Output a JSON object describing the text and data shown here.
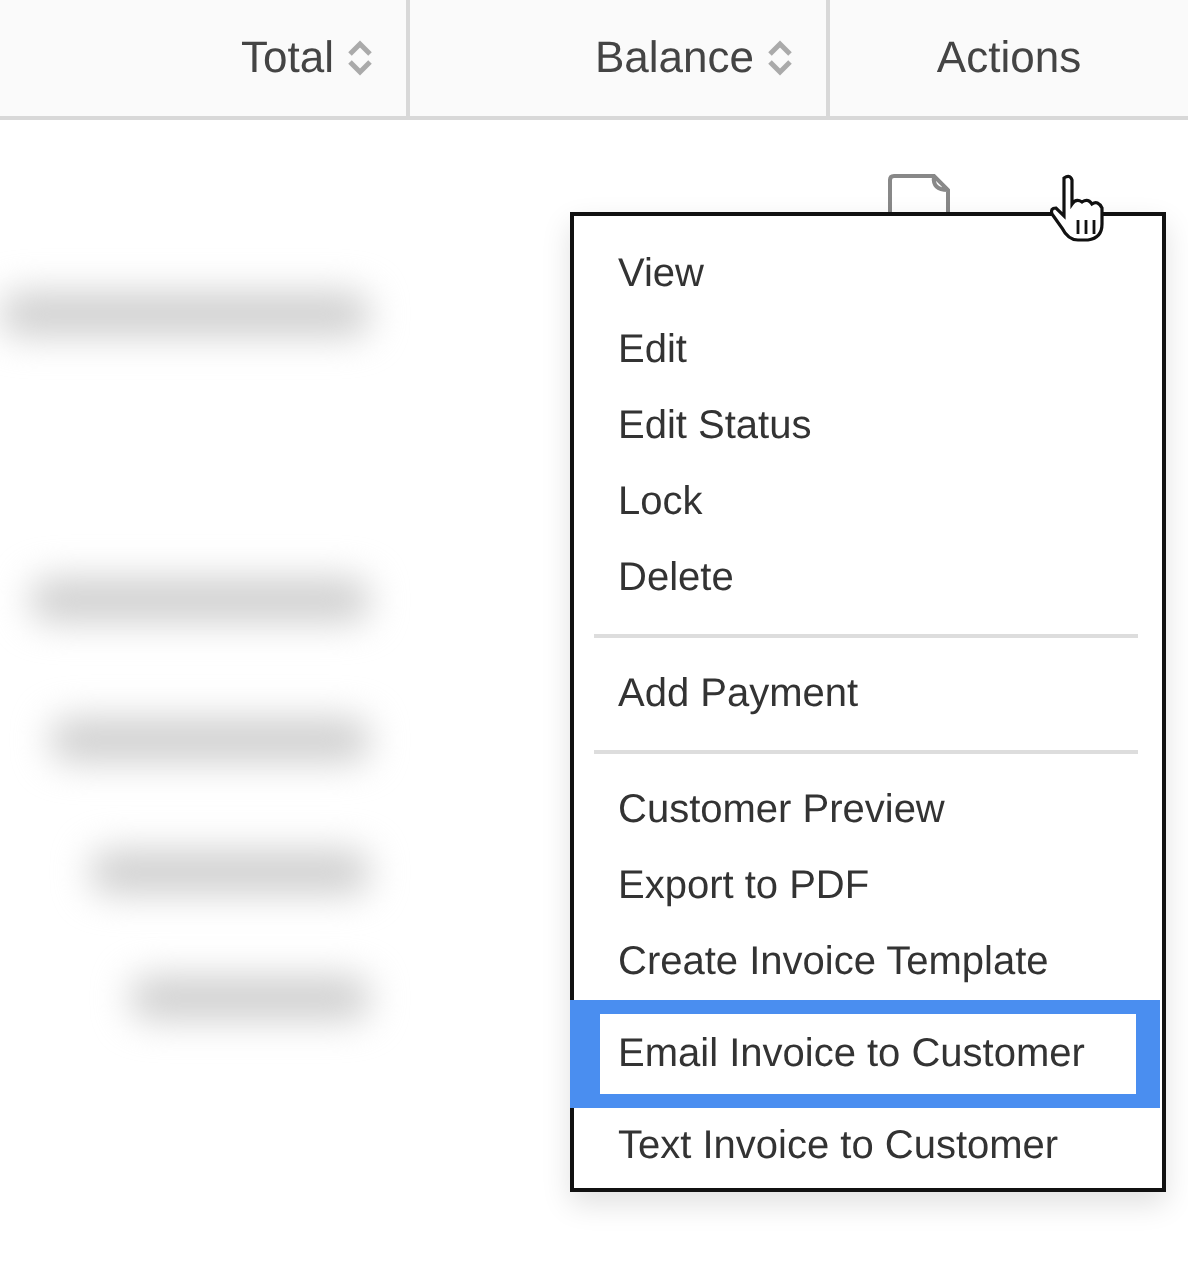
{
  "table": {
    "columns": [
      {
        "label": "Total",
        "sortable": true
      },
      {
        "label": "Balance",
        "sortable": true
      },
      {
        "label": "Actions",
        "sortable": false
      }
    ]
  },
  "menu": {
    "groups": [
      {
        "items": [
          {
            "label": "View",
            "highlighted": false
          },
          {
            "label": "Edit",
            "highlighted": false
          },
          {
            "label": "Edit Status",
            "highlighted": false
          },
          {
            "label": "Lock",
            "highlighted": false
          },
          {
            "label": "Delete",
            "highlighted": false
          }
        ]
      },
      {
        "items": [
          {
            "label": "Add Payment",
            "highlighted": false
          }
        ]
      },
      {
        "items": [
          {
            "label": "Customer Preview",
            "highlighted": false
          },
          {
            "label": "Export to PDF",
            "highlighted": false
          },
          {
            "label": "Create Invoice Template",
            "highlighted": false
          },
          {
            "label": "Email Invoice to Customer",
            "highlighted": true
          },
          {
            "label": "Text Invoice to Customer",
            "highlighted": false
          }
        ]
      }
    ]
  }
}
